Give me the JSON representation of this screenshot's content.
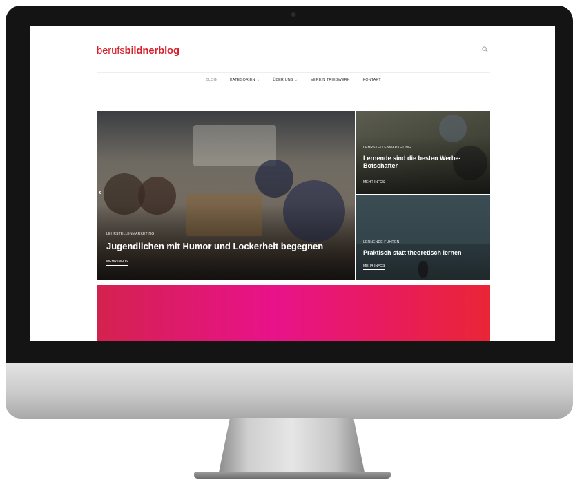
{
  "logo": {
    "part1": "berufs",
    "part2": "bildner",
    "part3": "blog",
    "cursor": "_"
  },
  "nav": [
    {
      "label": "BLOG",
      "dropdown": false
    },
    {
      "label": "KATEGORIEN",
      "dropdown": true
    },
    {
      "label": "ÜBER UNS",
      "dropdown": true
    },
    {
      "label": "VEREIN TRIEBWERK",
      "dropdown": false
    },
    {
      "label": "KONTAKT",
      "dropdown": false
    }
  ],
  "slides": {
    "main": {
      "category": "LEHRSTELLENMARKETING",
      "title": "Jugendlichen mit Humor und Lockerheit begegnen",
      "more": "MEHR INFOS"
    },
    "top_right": {
      "category": "LEHRSTELLENMARKETING",
      "title": "Lernende sind die besten Werbe-Botschafter",
      "more": "MEHR INFOS"
    },
    "bottom_right": {
      "category": "LERNENDE FÜHREN",
      "title": "Praktisch statt theoretisch lernen",
      "more": "MEHR INFOS"
    }
  },
  "icons": {
    "search": "search-icon",
    "prev": "chevron-left-icon",
    "next": "chevron-right-icon"
  },
  "colors": {
    "brand": "#d3202b",
    "banner_start": "#d4224f",
    "banner_mid": "#e8128a",
    "banner_end": "#ea2536"
  }
}
